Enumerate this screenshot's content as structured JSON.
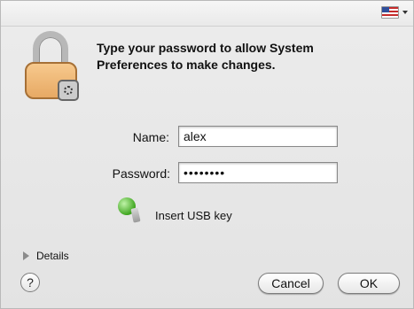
{
  "dialog": {
    "prompt": "Type your password to allow System Preferences to make changes.",
    "fields": {
      "name": {
        "label": "Name:",
        "value": "alex"
      },
      "password": {
        "label": "Password:",
        "value": "••••••••"
      }
    },
    "usb": {
      "label": "Insert USB key"
    },
    "details": {
      "label": "Details"
    },
    "buttons": {
      "help": "?",
      "cancel": "Cancel",
      "ok": "OK"
    },
    "icons": {
      "lock": "lock-icon",
      "usb": "usb-key-icon",
      "flag": "us-flag-icon",
      "details": "triangle-right-icon",
      "help": "question-mark-icon"
    }
  }
}
